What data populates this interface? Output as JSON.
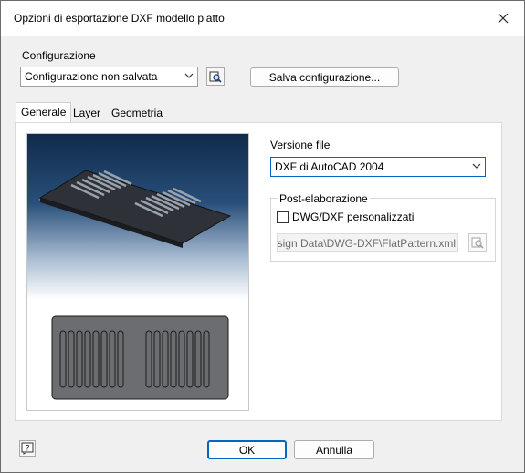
{
  "window": {
    "title": "Opzioni di esportazione DXF modello piatto"
  },
  "config": {
    "label": "Configurazione",
    "selected": "Configurazione non salvata",
    "save_label": "Salva configurazione..."
  },
  "tabs": [
    {
      "label": "Generale",
      "active": true
    },
    {
      "label": "Layer",
      "active": false
    },
    {
      "label": "Geometria",
      "active": false
    }
  ],
  "general": {
    "version_label": "Versione file",
    "version_selected": "DXF di AutoCAD 2004",
    "post_label": "Post-elaborazione",
    "custom_label": "DWG/DXF personalizzati",
    "custom_checked": false,
    "path": "Design Data\\DWG-DXF\\FlatPattern.xml"
  },
  "footer": {
    "ok_label": "OK",
    "cancel_label": "Annulla"
  },
  "colors": {
    "accent": "#0067c0",
    "preview_top": "#102b4a"
  }
}
